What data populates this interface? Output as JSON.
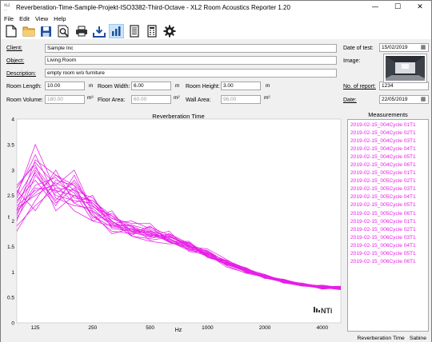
{
  "window": {
    "title": "Reverberation-Time-Sample-Projekt-ISO3382-Third-Octave - XL2 Room Acoustics Reporter 1.20",
    "icon_text": "XL2 ...",
    "minimize": "—",
    "maximize": "☐",
    "close": "✕"
  },
  "menu": [
    "File",
    "Edit",
    "View",
    "Help"
  ],
  "toolbar": [
    {
      "name": "new-file-icon"
    },
    {
      "name": "open-folder-icon"
    },
    {
      "name": "save-icon"
    },
    {
      "name": "print-preview-icon"
    },
    {
      "name": "print-icon"
    },
    {
      "name": "export-icon"
    },
    {
      "name": "chart-view-icon",
      "selected": true
    },
    {
      "name": "report-icon"
    },
    {
      "name": "table-icon"
    },
    {
      "name": "settings-gear-icon"
    }
  ],
  "form": {
    "client_label": "Client:",
    "client": "Sample Inc",
    "object_label": "Object:",
    "object": "Living Room",
    "description_label": "Description:",
    "description": "empty room w/o furniture",
    "room_length_label": "Room Length:",
    "room_length": "10.00",
    "room_length_unit": "m",
    "room_width_label": "Room Width:",
    "room_width": "6.00",
    "room_width_unit": "m",
    "room_height_label": "Room Height:",
    "room_height": "3.00",
    "room_height_unit": "m",
    "room_volume_label": "Room Volume:",
    "room_volume": "180.00",
    "room_volume_unit": "m³",
    "floor_area_label": "Floor Area:",
    "floor_area": "60.00",
    "floor_area_unit": "m²",
    "wall_area_label": "Wall Area:",
    "wall_area": "96.00",
    "wall_area_unit": "m²",
    "date_of_test_label": "Date of test:",
    "date_of_test": "15/02/2019",
    "image_label": "Image:",
    "no_of_report_label": "No. of report:",
    "no_of_report": "1234",
    "date_label": "Date:",
    "date": "22/05/2019"
  },
  "measurements": {
    "title": "Measurements",
    "items": [
      {
        "name": "2019-02-15_004Cycle 01",
        "type": "T1"
      },
      {
        "name": "2019-02-15_004Cycle 02",
        "type": "T1"
      },
      {
        "name": "2019-02-15_004Cycle 03",
        "type": "T1"
      },
      {
        "name": "2019-02-15_004Cycle 04",
        "type": "T1"
      },
      {
        "name": "2019-02-15_004Cycle 05",
        "type": "T1"
      },
      {
        "name": "2019-02-15_004Cycle 06",
        "type": "T1"
      },
      {
        "name": "2019-02-15_005Cycle 01",
        "type": "T1"
      },
      {
        "name": "2019-02-15_005Cycle 02",
        "type": "T1"
      },
      {
        "name": "2019-02-15_005Cycle 03",
        "type": "T1"
      },
      {
        "name": "2019-02-15_005Cycle 04",
        "type": "T1"
      },
      {
        "name": "2019-02-15_005Cycle 05",
        "type": "T1"
      },
      {
        "name": "2019-02-15_005Cycle 06",
        "type": "T1"
      },
      {
        "name": "2019-02-15_006Cycle 01",
        "type": "T1"
      },
      {
        "name": "2019-02-15_006Cycle 02",
        "type": "T1"
      },
      {
        "name": "2019-02-15_006Cycle 03",
        "type": "T1"
      },
      {
        "name": "2019-02-15_006Cycle 04",
        "type": "T1"
      },
      {
        "name": "2019-02-15_006Cycle 05",
        "type": "T1"
      },
      {
        "name": "2019-02-15_006Cycle 06",
        "type": "T1"
      }
    ]
  },
  "status": {
    "left": "Reverberation Time",
    "right": "Sabine"
  },
  "colors": {
    "series": "#e61ee6",
    "selected_tool": "#cce4f7"
  },
  "chart_data": {
    "type": "line",
    "title": "Reverberation Time",
    "xlabel": "Hz",
    "ylabel": "t",
    "x_scale": "log",
    "x": [
      100,
      125,
      160,
      200,
      250,
      315,
      400,
      500,
      630,
      800,
      1000,
      1250,
      1600,
      2000,
      2500,
      3150,
      4000,
      5000
    ],
    "x_ticks": [
      {
        "v": 125,
        "label": "125"
      },
      {
        "v": 250,
        "label": "250"
      },
      {
        "v": 500,
        "label": "500"
      },
      {
        "v": 1000,
        "label": "1000"
      },
      {
        "v": 2000,
        "label": "2000"
      },
      {
        "v": 4000,
        "label": "4000"
      }
    ],
    "ylim": [
      0,
      4
    ],
    "y_ticks": [
      0,
      0.5,
      1,
      1.5,
      2,
      2.5,
      3,
      3.5,
      4
    ],
    "grid": false,
    "logo": "NTi",
    "series": [
      {
        "values": [
          2.5,
          3.5,
          2.6,
          2.2,
          2.0,
          1.9,
          1.85,
          1.8,
          1.7,
          1.5,
          1.35,
          1.15,
          1.0,
          0.9,
          0.8,
          0.75,
          0.7,
          0.68
        ]
      },
      {
        "values": [
          2.2,
          3.2,
          2.9,
          2.6,
          2.1,
          1.8,
          1.75,
          1.9,
          1.6,
          1.45,
          1.3,
          1.2,
          1.05,
          0.95,
          0.82,
          0.74,
          0.72,
          0.7
        ]
      },
      {
        "values": [
          2.0,
          2.9,
          2.4,
          2.8,
          2.3,
          2.0,
          1.7,
          1.65,
          1.75,
          1.55,
          1.4,
          1.2,
          1.0,
          0.88,
          0.8,
          0.78,
          0.69,
          0.66
        ]
      },
      {
        "values": [
          2.7,
          3.1,
          2.2,
          2.5,
          2.4,
          2.1,
          1.9,
          1.75,
          1.6,
          1.6,
          1.3,
          1.15,
          1.05,
          0.92,
          0.85,
          0.73,
          0.68,
          0.71
        ]
      },
      {
        "values": [
          2.3,
          2.6,
          2.7,
          3.0,
          2.2,
          1.95,
          2.0,
          1.85,
          1.65,
          1.5,
          1.45,
          1.25,
          1.02,
          0.9,
          0.83,
          0.76,
          0.7,
          0.67
        ]
      },
      {
        "values": [
          1.8,
          2.4,
          3.0,
          2.35,
          2.5,
          1.85,
          1.8,
          1.7,
          1.8,
          1.4,
          1.35,
          1.1,
          0.98,
          0.93,
          0.79,
          0.72,
          0.74,
          0.69
        ]
      },
      {
        "values": [
          2.6,
          2.2,
          2.8,
          2.7,
          2.05,
          2.2,
          1.7,
          1.6,
          1.55,
          1.58,
          1.28,
          1.18,
          1.08,
          0.89,
          0.84,
          0.77,
          0.67,
          0.68
        ]
      },
      {
        "values": [
          2.1,
          3.0,
          2.5,
          2.4,
          2.35,
          2.05,
          1.95,
          1.95,
          1.6,
          1.42,
          1.38,
          1.22,
          1.0,
          0.91,
          0.81,
          0.73,
          0.71,
          0.72
        ]
      },
      {
        "values": [
          2.4,
          2.8,
          2.3,
          2.9,
          2.15,
          1.75,
          1.85,
          1.72,
          1.7,
          1.52,
          1.32,
          1.14,
          1.04,
          0.87,
          0.86,
          0.75,
          0.69,
          0.65
        ]
      },
      {
        "values": [
          1.9,
          2.3,
          2.65,
          2.6,
          2.45,
          2.0,
          1.75,
          1.8,
          1.62,
          1.48,
          1.42,
          1.19,
          0.99,
          0.94,
          0.78,
          0.74,
          0.73,
          0.7
        ]
      },
      {
        "values": [
          2.55,
          3.3,
          2.45,
          2.3,
          2.25,
          1.9,
          1.9,
          1.62,
          1.68,
          1.55,
          1.33,
          1.21,
          1.06,
          0.9,
          0.82,
          0.76,
          0.66,
          0.69
        ]
      },
      {
        "values": [
          2.25,
          2.5,
          2.75,
          2.55,
          2.0,
          2.15,
          1.8,
          1.78,
          1.58,
          1.46,
          1.37,
          1.16,
          1.01,
          0.92,
          0.83,
          0.72,
          0.7,
          0.71
        ]
      },
      {
        "values": [
          2.45,
          3.05,
          2.55,
          2.75,
          2.3,
          1.95,
          1.72,
          1.88,
          1.72,
          1.53,
          1.3,
          1.17,
          1.03,
          0.88,
          0.8,
          0.77,
          0.72,
          0.67
        ]
      },
      {
        "values": [
          2.15,
          2.7,
          2.85,
          2.45,
          2.4,
          2.05,
          1.88,
          1.7,
          1.64,
          1.5,
          1.36,
          1.23,
          1.07,
          0.93,
          0.84,
          0.73,
          0.68,
          0.7
        ]
      },
      {
        "values": [
          2.35,
          2.95,
          2.35,
          2.65,
          2.1,
          1.88,
          1.82,
          1.76,
          1.66,
          1.44,
          1.4,
          1.13,
          0.97,
          0.9,
          0.81,
          0.75,
          0.71,
          0.66
        ]
      },
      {
        "values": [
          2.05,
          2.65,
          2.6,
          2.5,
          2.28,
          2.1,
          1.78,
          1.68,
          1.74,
          1.56,
          1.34,
          1.2,
          1.02,
          0.91,
          0.79,
          0.74,
          0.69,
          0.69
        ]
      },
      {
        "values": [
          2.65,
          3.15,
          2.7,
          2.35,
          2.18,
          1.92,
          1.92,
          1.82,
          1.59,
          1.49,
          1.31,
          1.18,
          1.05,
          0.89,
          0.85,
          0.76,
          0.7,
          0.68
        ]
      },
      {
        "values": [
          2.2,
          2.55,
          2.9,
          2.7,
          2.35,
          1.98,
          1.84,
          1.73,
          1.69,
          1.51,
          1.39,
          1.16,
          1.0,
          0.94,
          0.82,
          0.73,
          0.72,
          0.7
        ]
      }
    ]
  }
}
